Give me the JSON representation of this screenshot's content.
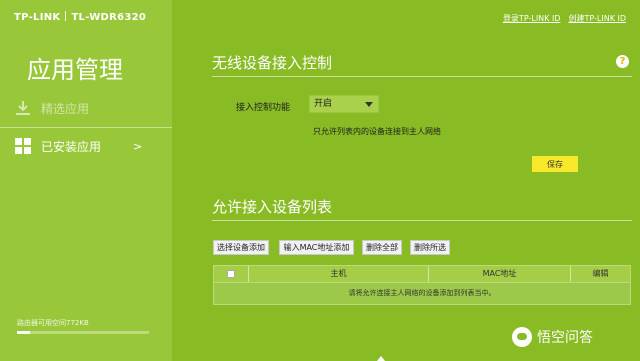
{
  "brand": {
    "logo": "TP-LINK",
    "model": "TL-WDR6320"
  },
  "top_links": {
    "login": "登录TP-LINK ID",
    "create": "创建TP-LINK ID"
  },
  "sidebar": {
    "title": "应用管理",
    "items": [
      {
        "label": "精选应用",
        "icon": "download-icon",
        "state": "disabled"
      },
      {
        "label": "已安装应用",
        "icon": "grid-icon",
        "chevron": ">"
      }
    ],
    "storage_label": "路由器可用空间772KB",
    "storage_fraction": 0.1
  },
  "help": {
    "icon": "question-icon",
    "glyph": "?"
  },
  "access_control": {
    "title": "无线设备接入控制",
    "field_label": "接入控制功能",
    "select_value": "开启",
    "hint": "只允许列表内的设备连接到主人网络",
    "save_label": "保存"
  },
  "allowed_list": {
    "title": "允许接入设备列表",
    "buttons": [
      "选择设备添加",
      "输入MAC地址添加",
      "删除全部",
      "删除所选"
    ],
    "columns": [
      "主机",
      "MAC地址",
      "编辑"
    ],
    "empty_message": "请将允许连接主人网络的设备添加到列表当中。"
  },
  "watermark": {
    "text": "悟空问答"
  },
  "colors": {
    "main_bg": "#88bb24",
    "sidebar_bg": "#99c73a",
    "save_button": "#f7e82a"
  }
}
